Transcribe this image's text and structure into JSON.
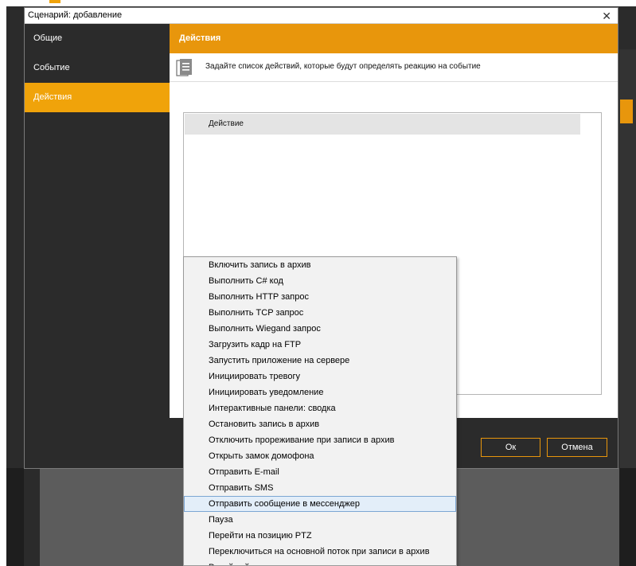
{
  "dialog": {
    "title": "Сценарий: добавление",
    "close_glyph": "✕"
  },
  "sidebar": {
    "items": [
      {
        "label": "Общие"
      },
      {
        "label": "Событие"
      },
      {
        "label": "Действия"
      }
    ],
    "active_index": 2
  },
  "content": {
    "header": "Действия",
    "hint": "Задайте список действий, которые будут определять реакцию на событие",
    "hint_icon": "document-list-icon",
    "table": {
      "column_header": "Действие"
    }
  },
  "footer": {
    "ok_label": "Ок",
    "cancel_label": "Отмена"
  },
  "dropdown": {
    "highlighted_index": 15,
    "items": [
      "Включить запись в архив",
      "Выполнить C# код",
      "Выполнить HTTP запрос",
      "Выполнить TCP запрос",
      "Выполнить Wiegand запрос",
      "Загрузить кадр на FTP",
      "Запустить приложение на сервере",
      "Инициировать тревогу",
      "Инициировать уведомление",
      "Интерактивные панели: сводка",
      "Остановить запись в архив",
      "Отключить прореживание при записи в архив",
      "Открыть замок домофона",
      "Отправить E-mail",
      "Отправить SMS",
      "Отправить сообщение в мессенджер",
      "Пауза",
      "Перейти на позицию PTZ",
      "Переключиться на основной поток при записи в архив",
      "Релейный модуль: установить значение порта"
    ]
  },
  "colors": {
    "accent": "#f0a30a",
    "accent_dark": "#e8960c",
    "panel_dark": "#2b2b2b",
    "hover_bg": "#e3eef9"
  }
}
